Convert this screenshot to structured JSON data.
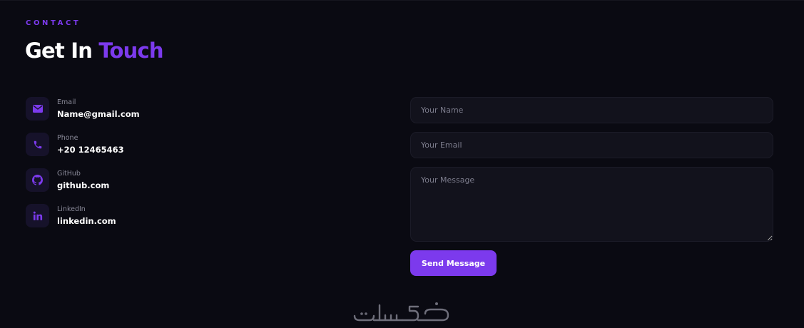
{
  "section": {
    "eyebrow": "CONTACT",
    "title_plain": "Get In ",
    "title_accent": "Touch"
  },
  "contacts": [
    {
      "icon": "envelope-icon",
      "label": "Email",
      "value": "Name@gmail.com"
    },
    {
      "icon": "phone-icon",
      "label": "Phone",
      "value": "+20 12465463"
    },
    {
      "icon": "github-icon",
      "label": "GitHub",
      "value": "github.com"
    },
    {
      "icon": "linkedin-icon",
      "label": "LinkedIn",
      "value": "linkedin.com"
    }
  ],
  "form": {
    "name_placeholder": "Your Name",
    "email_placeholder": "Your Email",
    "message_placeholder": "Your Message",
    "submit_label": "Send Message"
  },
  "watermark": {
    "text": "خمسات"
  },
  "colors": {
    "background": "#0a0a12",
    "accent": "#7c3aed",
    "icon_box": "#16122a",
    "field_bg": "#12121c"
  }
}
